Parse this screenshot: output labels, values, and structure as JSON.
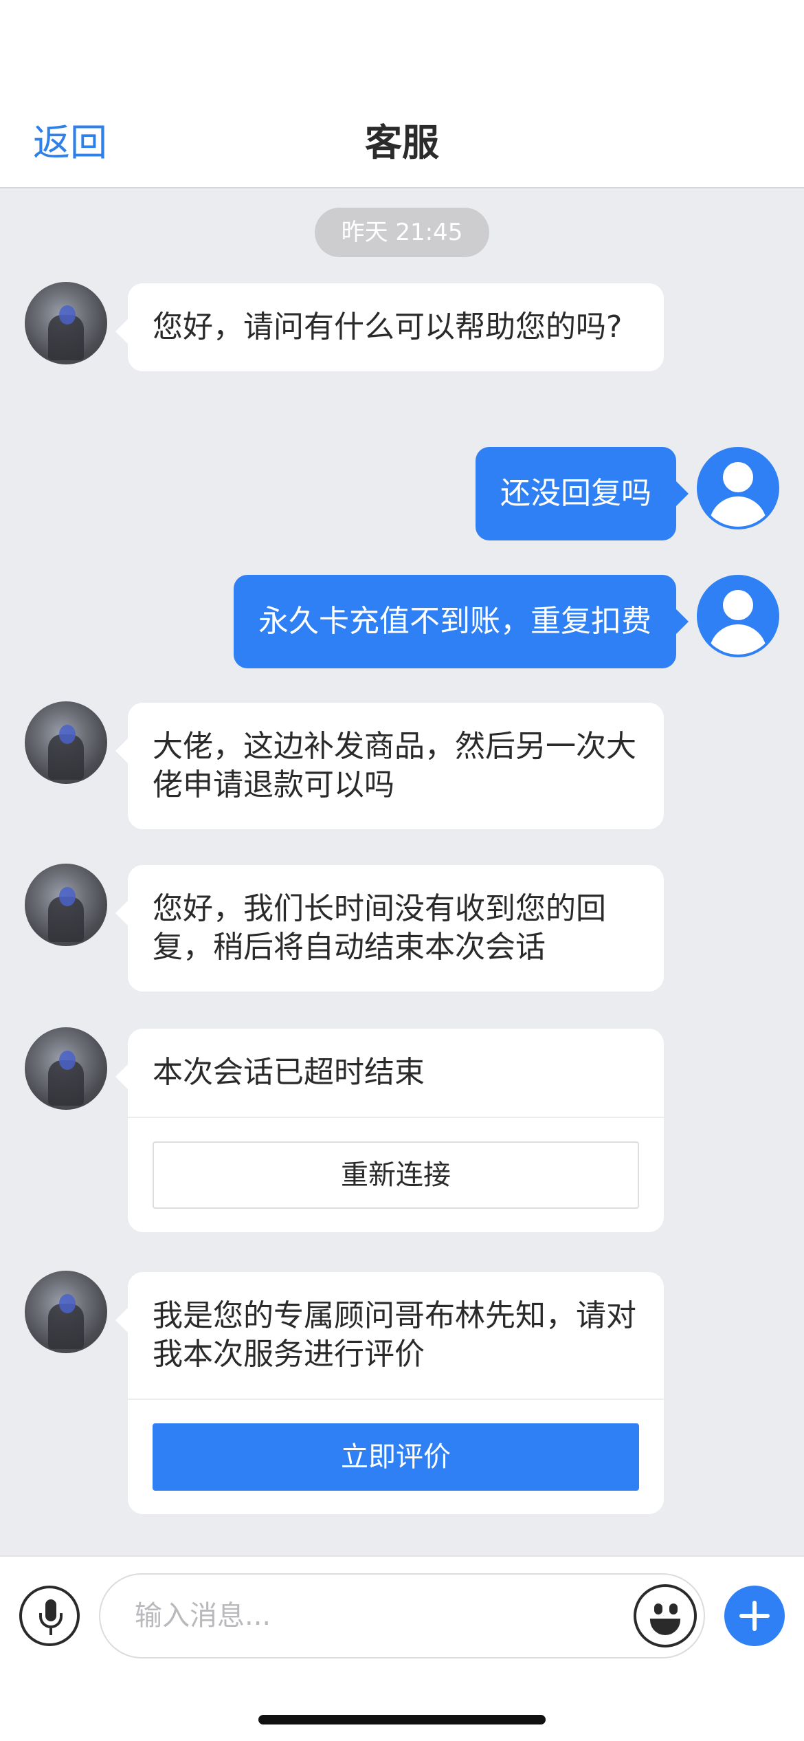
{
  "header": {
    "back_label": "返回",
    "title": "客服"
  },
  "chat": {
    "timestamp": "昨天 21:45",
    "messages": [
      {
        "from": "agent",
        "text": "您好，请问有什么可以帮助您的吗?"
      },
      {
        "from": "user",
        "text": "还没回复吗"
      },
      {
        "from": "user",
        "text": "永久卡充值不到账，重复扣费"
      },
      {
        "from": "agent",
        "text": "大佬，这边补发商品，然后另一次大佬申请退款可以吗"
      },
      {
        "from": "agent",
        "text": "您好，我们长时间没有收到您的回复，稍后将自动结束本次会话"
      },
      {
        "from": "agent",
        "text": "本次会话已超时结束",
        "action_label": "重新连接"
      },
      {
        "from": "agent",
        "text": "我是您的专属顾问哥布林先知，请对我本次服务进行评价",
        "action_label": "立即评价"
      }
    ]
  },
  "input_bar": {
    "placeholder": "输入消息..."
  },
  "icons": {
    "mic": "microphone-icon",
    "emoji": "emoji-icon",
    "plus": "plus-icon",
    "agent_avatar": "agent-avatar",
    "user_avatar": "user-avatar-icon"
  },
  "colors": {
    "accent": "#2f80f5",
    "background": "#ebecef"
  }
}
